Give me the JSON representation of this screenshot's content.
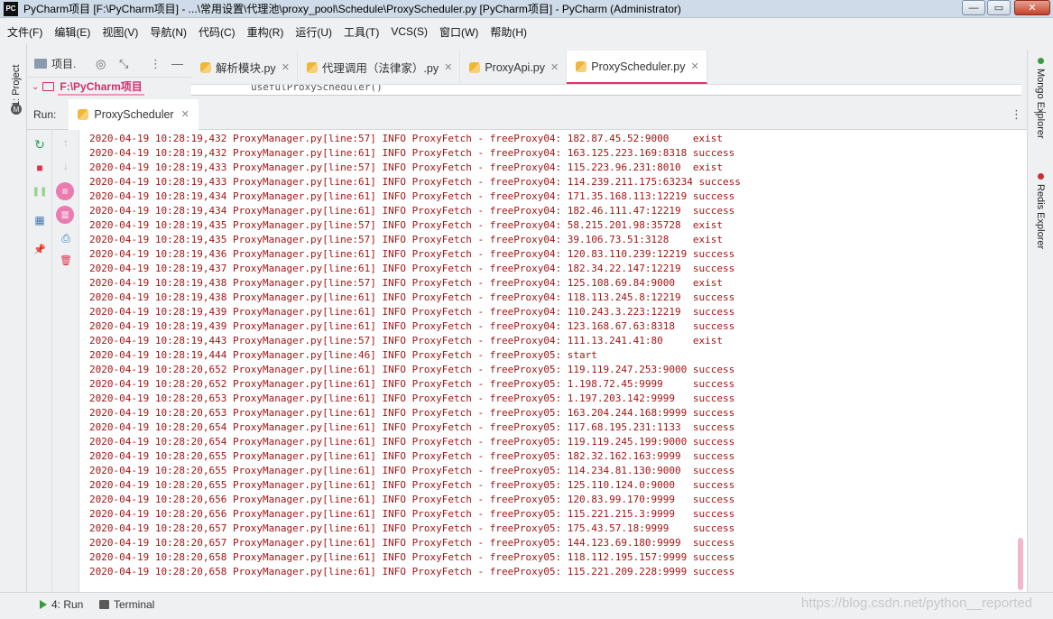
{
  "window": {
    "title": "PyCharm项目 [F:\\PyCharm项目] - ...\\常用设置\\代理池\\proxy_pool\\Schedule\\ProxyScheduler.py [PyCharm项目] - PyCharm (Administrator)",
    "app_icon_text": "PC",
    "controls": {
      "minimize": "—",
      "maximize": "▭",
      "close": "✕"
    }
  },
  "menu": [
    "文件(F)",
    "编辑(E)",
    "视图(V)",
    "导航(N)",
    "代码(C)",
    "重构(R)",
    "运行(U)",
    "工具(T)",
    "VCS(S)",
    "窗口(W)",
    "帮助(H)"
  ],
  "left_strip": {
    "project_tab": "1: Project",
    "bottom_icon": "M"
  },
  "project_panel": {
    "label": "项目.",
    "root": "F:\\PyCharm项目",
    "icons": {
      "locate": "◎",
      "collapse": "⤡",
      "more": "⋮",
      "hide": "—"
    }
  },
  "editor": {
    "tabs": [
      {
        "label": "解析模块.py",
        "active": false,
        "close": "✕"
      },
      {
        "label": "代理调用（法律家）.py",
        "active": false,
        "close": "✕"
      },
      {
        "label": "ProxyApi.py",
        "active": false,
        "close": "✕"
      },
      {
        "label": "ProxyScheduler.py",
        "active": true,
        "close": "✕"
      }
    ],
    "code_peek": "usefulProxyScheduler()"
  },
  "right_strip": {
    "mongo": "Mongo Explorer",
    "redis": "Redis Explorer"
  },
  "run_panel": {
    "label": "Run:",
    "tab": "ProxyScheduler",
    "tab_close": "✕",
    "more": "⋮",
    "minimize": "—",
    "toolbar_left": {
      "rerun": "↻",
      "stop": "■",
      "pause": "❚❚",
      "layout": "▦",
      "pin": "📌"
    },
    "toolbar_right": {
      "up": "↑",
      "down": "↓",
      "soft_wrap": "≡",
      "scroll_end": "≣",
      "print": "⎙",
      "clear": "🗑"
    }
  },
  "console_lines": [
    "2020-04-19 10:28:19,432 ProxyManager.py[line:57] INFO ProxyFetch - freeProxy04: 182.87.45.52:9000    exist",
    "2020-04-19 10:28:19,432 ProxyManager.py[line:61] INFO ProxyFetch - freeProxy04: 163.125.223.169:8318 success",
    "2020-04-19 10:28:19,433 ProxyManager.py[line:57] INFO ProxyFetch - freeProxy04: 115.223.96.231:8010  exist",
    "2020-04-19 10:28:19,433 ProxyManager.py[line:61] INFO ProxyFetch - freeProxy04: 114.239.211.175:63234 success",
    "2020-04-19 10:28:19,434 ProxyManager.py[line:61] INFO ProxyFetch - freeProxy04: 171.35.168.113:12219 success",
    "2020-04-19 10:28:19,434 ProxyManager.py[line:61] INFO ProxyFetch - freeProxy04: 182.46.111.47:12219  success",
    "2020-04-19 10:28:19,435 ProxyManager.py[line:57] INFO ProxyFetch - freeProxy04: 58.215.201.98:35728  exist",
    "2020-04-19 10:28:19,435 ProxyManager.py[line:57] INFO ProxyFetch - freeProxy04: 39.106.73.51:3128    exist",
    "2020-04-19 10:28:19,436 ProxyManager.py[line:61] INFO ProxyFetch - freeProxy04: 120.83.110.239:12219 success",
    "2020-04-19 10:28:19,437 ProxyManager.py[line:61] INFO ProxyFetch - freeProxy04: 182.34.22.147:12219  success",
    "2020-04-19 10:28:19,438 ProxyManager.py[line:57] INFO ProxyFetch - freeProxy04: 125.108.69.84:9000   exist",
    "2020-04-19 10:28:19,438 ProxyManager.py[line:61] INFO ProxyFetch - freeProxy04: 118.113.245.8:12219  success",
    "2020-04-19 10:28:19,439 ProxyManager.py[line:61] INFO ProxyFetch - freeProxy04: 110.243.3.223:12219  success",
    "2020-04-19 10:28:19,439 ProxyManager.py[line:61] INFO ProxyFetch - freeProxy04: 123.168.67.63:8318   success",
    "2020-04-19 10:28:19,443 ProxyManager.py[line:57] INFO ProxyFetch - freeProxy04: 111.13.241.41:80     exist",
    "2020-04-19 10:28:19,444 ProxyManager.py[line:46] INFO ProxyFetch - freeProxy05: start",
    "2020-04-19 10:28:20,652 ProxyManager.py[line:61] INFO ProxyFetch - freeProxy05: 119.119.247.253:9000 success",
    "2020-04-19 10:28:20,652 ProxyManager.py[line:61] INFO ProxyFetch - freeProxy05: 1.198.72.45:9999     success",
    "2020-04-19 10:28:20,653 ProxyManager.py[line:61] INFO ProxyFetch - freeProxy05: 1.197.203.142:9999   success",
    "2020-04-19 10:28:20,653 ProxyManager.py[line:61] INFO ProxyFetch - freeProxy05: 163.204.244.168:9999 success",
    "2020-04-19 10:28:20,654 ProxyManager.py[line:61] INFO ProxyFetch - freeProxy05: 117.68.195.231:1133  success",
    "2020-04-19 10:28:20,654 ProxyManager.py[line:61] INFO ProxyFetch - freeProxy05: 119.119.245.199:9000 success",
    "2020-04-19 10:28:20,655 ProxyManager.py[line:61] INFO ProxyFetch - freeProxy05: 182.32.162.163:9999  success",
    "2020-04-19 10:28:20,655 ProxyManager.py[line:61] INFO ProxyFetch - freeProxy05: 114.234.81.130:9000  success",
    "2020-04-19 10:28:20,655 ProxyManager.py[line:61] INFO ProxyFetch - freeProxy05: 125.110.124.0:9000   success",
    "2020-04-19 10:28:20,656 ProxyManager.py[line:61] INFO ProxyFetch - freeProxy05: 120.83.99.170:9999   success",
    "2020-04-19 10:28:20,656 ProxyManager.py[line:61] INFO ProxyFetch - freeProxy05: 115.221.215.3:9999   success",
    "2020-04-19 10:28:20,657 ProxyManager.py[line:61] INFO ProxyFetch - freeProxy05: 175.43.57.18:9999    success",
    "2020-04-19 10:28:20,657 ProxyManager.py[line:61] INFO ProxyFetch - freeProxy05: 144.123.69.180:9999  success",
    "2020-04-19 10:28:20,658 ProxyManager.py[line:61] INFO ProxyFetch - freeProxy05: 118.112.195.157:9999 success",
    "2020-04-19 10:28:20,658 ProxyManager.py[line:61] INFO ProxyFetch - freeProxy05: 115.221.209.228:9999 success"
  ],
  "statusbar": {
    "run": "4: Run",
    "terminal": "Terminal"
  },
  "watermark": "https://blog.csdn.net/python__reported",
  "colors": {
    "console_text": "#a31515",
    "accent": "#e0306a",
    "python_icon": "#f2b635",
    "stop": "#e0304e",
    "rerun": "#2f9e5b"
  }
}
